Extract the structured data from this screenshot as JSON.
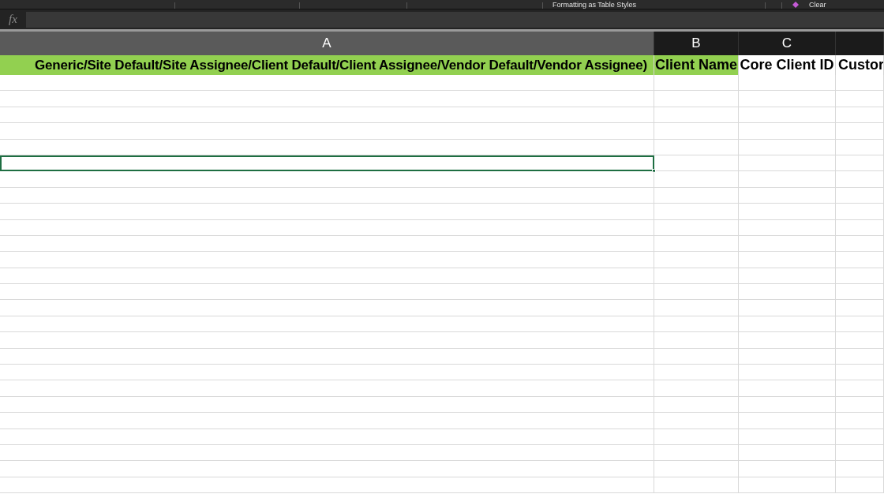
{
  "ribbon": {
    "labels": [
      "Formatting  as Table   Styles",
      "Clear"
    ]
  },
  "formula_bar": {
    "icon_text": "fx"
  },
  "columns": [
    {
      "letter": "A",
      "selected": true
    },
    {
      "letter": "B",
      "selected": false
    },
    {
      "letter": "C",
      "selected": false
    },
    {
      "selected": false
    }
  ],
  "header_row": [
    {
      "text": "Generic/Site Default/Site Assignee/Client Default/Client Assignee/Vendor Default/Vendor Assignee)",
      "color": "#92d050"
    },
    {
      "text": "Client Name",
      "color": "#92d050"
    },
    {
      "text": "Core Client ID",
      "color": "#ffffff"
    },
    {
      "text": "Custor",
      "color": "#ffffff"
    }
  ],
  "rows": [
    {
      "selected": false
    },
    {
      "selected": false
    },
    {
      "selected": false
    },
    {
      "selected": false
    },
    {
      "selected": false
    },
    {
      "selected": true
    },
    {
      "selected": false
    },
    {
      "selected": false
    },
    {
      "selected": false
    },
    {
      "selected": false
    },
    {
      "selected": false
    },
    {
      "selected": false
    },
    {
      "selected": false
    },
    {
      "selected": false
    },
    {
      "selected": false
    },
    {
      "selected": false
    },
    {
      "selected": false
    },
    {
      "selected": false
    },
    {
      "selected": false
    },
    {
      "selected": false
    },
    {
      "selected": false
    },
    {
      "selected": false
    },
    {
      "selected": false
    },
    {
      "selected": false
    },
    {
      "selected": false
    },
    {
      "selected": false
    }
  ]
}
